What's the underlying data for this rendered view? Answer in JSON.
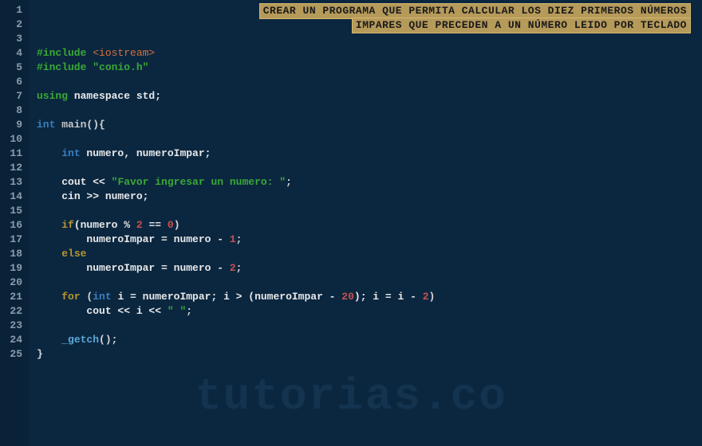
{
  "lineCount": 25,
  "comment": {
    "line1": "CREAR UN PROGRAMA QUE PERMITA CALCULAR LOS DIEZ PRIMEROS NÚMEROS",
    "line2": "IMPARES QUE PRECEDEN A UN NÚMERO LEIDO POR TECLADO"
  },
  "code": {
    "include1_pre": "#include ",
    "include1_sys": "<iostream>",
    "include2_pre": "#include ",
    "include2_str": "\"conio.h\"",
    "using_kw": "using",
    "using_rest": " namespace std;",
    "int_kw": "int",
    "main": " main",
    "main_paren": "(){",
    "decl_int": "int",
    "decl_vars": " numero, numeroImpar;",
    "cout1_a": "cout << ",
    "cout1_str": "\"Favor ingresar un numero: \"",
    "cout1_b": ";",
    "cin": "cin >> numero;",
    "if_kw": "if",
    "if_cond_a": "(numero % ",
    "if_num2": "2",
    "if_cond_b": " == ",
    "if_num0": "0",
    "if_cond_c": ")",
    "if_body_a": "numeroImpar = numero - ",
    "if_num1": "1",
    "if_body_b": ";",
    "else_kw": "else",
    "else_body_a": "numeroImpar = numero - ",
    "else_num2": "2",
    "else_body_b": ";",
    "for_kw": "for",
    "for_a": " (",
    "for_int": "int",
    "for_b": " i = numeroImpar; i > (numeroImpar - ",
    "for_num20": "20",
    "for_c": "); i = i - ",
    "for_num2b": "2",
    "for_d": ")",
    "for_body_a": "cout << i << ",
    "for_body_str": "\" \"",
    "for_body_b": ";",
    "getch": "_getch",
    "getch_b": "();",
    "close": "}"
  },
  "watermark": "tutorias.co"
}
